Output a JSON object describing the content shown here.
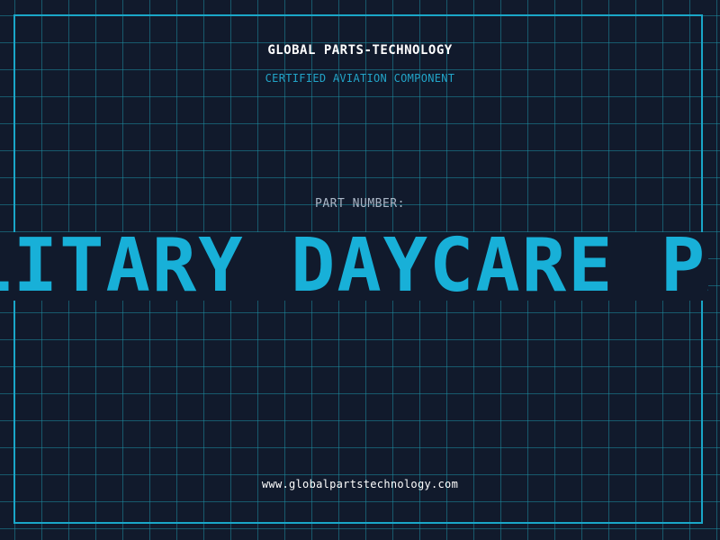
{
  "header": {
    "company_name": "GLOBAL PARTS-TECHNOLOGY",
    "tagline": "CERTIFIED AVIATION COMPONENT"
  },
  "part": {
    "label": "PART NUMBER:",
    "value": "MILITARY DAYCARE PART"
  },
  "footer": {
    "website": "www.globalpartstechnology.com"
  },
  "colors": {
    "background": "#111a2c",
    "grid": "#1d8ca0",
    "accent": "#1aa6c8",
    "text_white": "#ffffff",
    "label_grey": "#aab6c6"
  }
}
